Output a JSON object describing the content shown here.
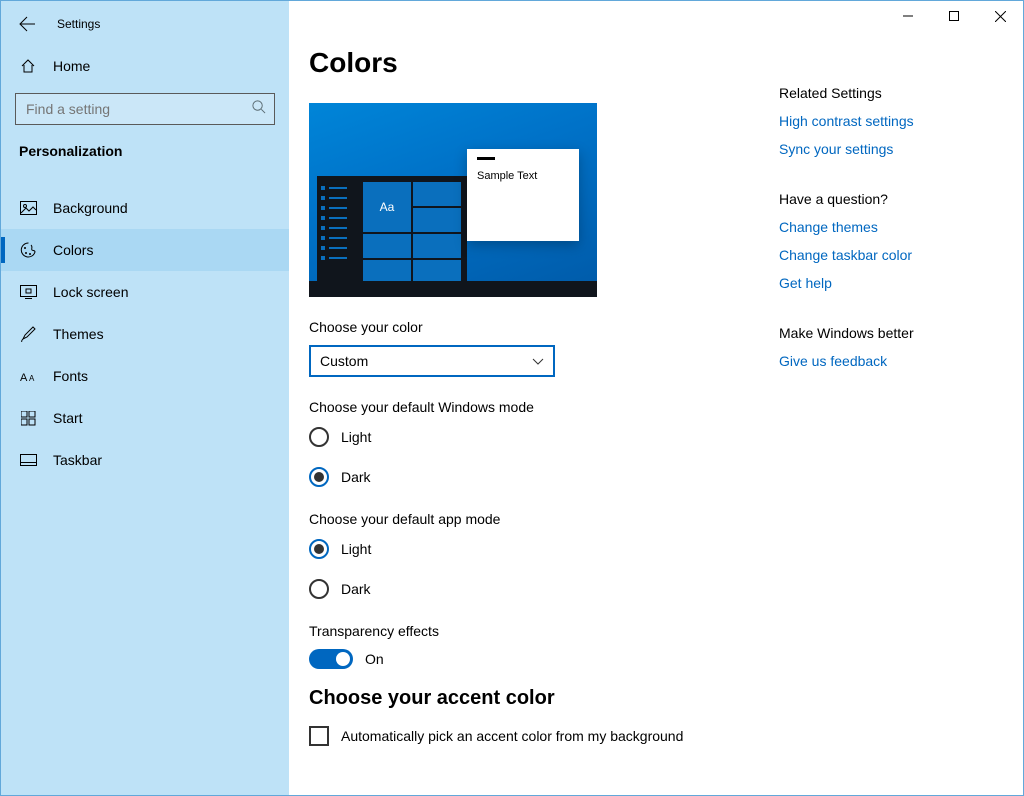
{
  "window_title": "Settings",
  "sidebar": {
    "home": "Home",
    "search_placeholder": "Find a setting",
    "category": "Personalization",
    "items": [
      {
        "label": "Background"
      },
      {
        "label": "Colors"
      },
      {
        "label": "Lock screen"
      },
      {
        "label": "Themes"
      },
      {
        "label": "Fonts"
      },
      {
        "label": "Start"
      },
      {
        "label": "Taskbar"
      }
    ],
    "active_index": 1
  },
  "page": {
    "title": "Colors",
    "preview": {
      "sample_text": "Sample Text",
      "tile_text": "Aa"
    },
    "choose_color": {
      "label": "Choose your color",
      "value": "Custom"
    },
    "windows_mode": {
      "label": "Choose your default Windows mode",
      "options": [
        "Light",
        "Dark"
      ],
      "selected": "Dark"
    },
    "app_mode": {
      "label": "Choose your default app mode",
      "options": [
        "Light",
        "Dark"
      ],
      "selected": "Light"
    },
    "transparency": {
      "label": "Transparency effects",
      "state": "On",
      "on": true
    },
    "accent": {
      "heading": "Choose your accent color",
      "auto_label": "Automatically pick an accent color from my background",
      "auto_checked": false
    }
  },
  "rail": {
    "related_title": "Related Settings",
    "related_links": [
      "High contrast settings",
      "Sync your settings"
    ],
    "question_title": "Have a question?",
    "question_links": [
      "Change themes",
      "Change taskbar color",
      "Get help"
    ],
    "better_title": "Make Windows better",
    "better_links": [
      "Give us feedback"
    ]
  }
}
